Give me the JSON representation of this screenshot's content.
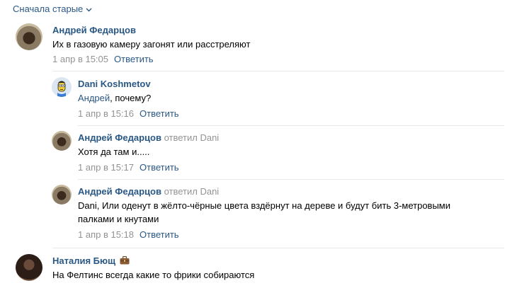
{
  "sort_label": "Сначала старые",
  "comments": [
    {
      "author": "Андрей Федарцов",
      "text": "Их в газовую камеру загонят или расстреляют",
      "date": "1 апр в 15:05",
      "reply_label": "Ответить"
    },
    {
      "author": "Dani Koshmetov",
      "mention": "Андрей",
      "text": ", почему?",
      "date": "1 апр в 15:16",
      "reply_label": "Ответить"
    },
    {
      "author": "Андрей Федарцов",
      "reply_to": "ответил Dani",
      "text": "Хотя да там и.....",
      "date": "1 апр в 15:17",
      "reply_label": "Ответить"
    },
    {
      "author": "Андрей Федарцов",
      "reply_to": "ответил Dani",
      "text_line1": "Dani, Или оденут в жёлто-чёрные цвета вздёрнут на дереве и будут бить 3-метровыми",
      "text_line2": "палками и кнутами",
      "date": "1 апр в 15:18",
      "reply_label": "Ответить"
    },
    {
      "author": "Наталия Бющ",
      "text": "На Фелтинс всегда какие то фрики собираются",
      "emoji": "briefcase-icon"
    }
  ],
  "colors": {
    "link": "#2a5885",
    "meta": "#939393",
    "divider": "#e7e8ec"
  }
}
